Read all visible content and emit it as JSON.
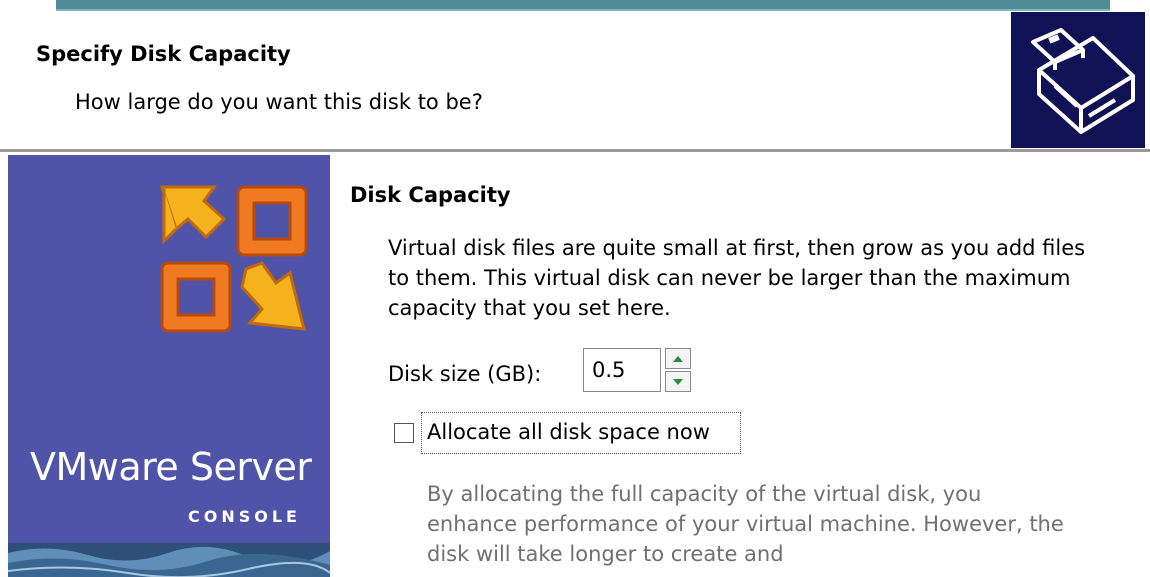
{
  "header": {
    "title": "Specify Disk Capacity",
    "subtitle": "How large do you want this disk to be?",
    "icon": "disk-drive-icon"
  },
  "brand": {
    "name": "VMware Server",
    "tagline": "CONSOLE",
    "logo_icon": "vmware-logo-icon"
  },
  "section": {
    "title": "Disk Capacity",
    "description": "Virtual disk files are quite small at first, then grow as you add files to them.  This virtual disk can never be larger than the maximum capacity that you set here."
  },
  "disk_size": {
    "label": "Disk size (GB):",
    "value": "0.5"
  },
  "allocate": {
    "label": "Allocate all disk space now",
    "checked": false
  },
  "allocate_note": "By allocating the full capacity of the virtual disk, you enhance performance of your virtual machine. However, the disk will take longer to create and",
  "colors": {
    "brand_panel": "#5054a8",
    "header_icon_bg": "#111155",
    "logo_orange": "#f07a22",
    "logo_yellow": "#f5b21c"
  }
}
